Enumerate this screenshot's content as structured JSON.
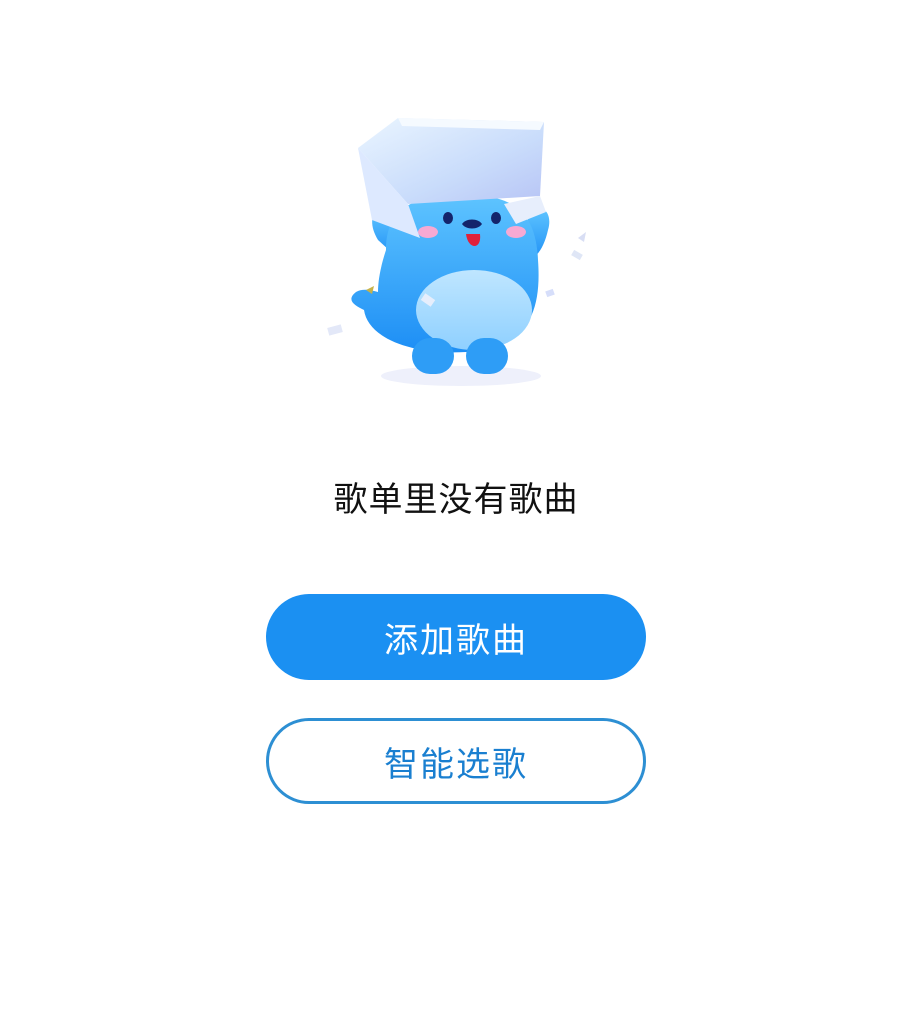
{
  "empty_state": {
    "message": "歌单里没有歌曲",
    "illustration": "mascot-with-box-on-head"
  },
  "actions": {
    "add_songs_label": "添加歌曲",
    "smart_pick_label": "智能选歌"
  },
  "colors": {
    "primary": "#1b90f2",
    "secondary_border": "#2d8fd3",
    "secondary_text": "#1a7fd0",
    "text": "#111111",
    "background": "#ffffff"
  }
}
